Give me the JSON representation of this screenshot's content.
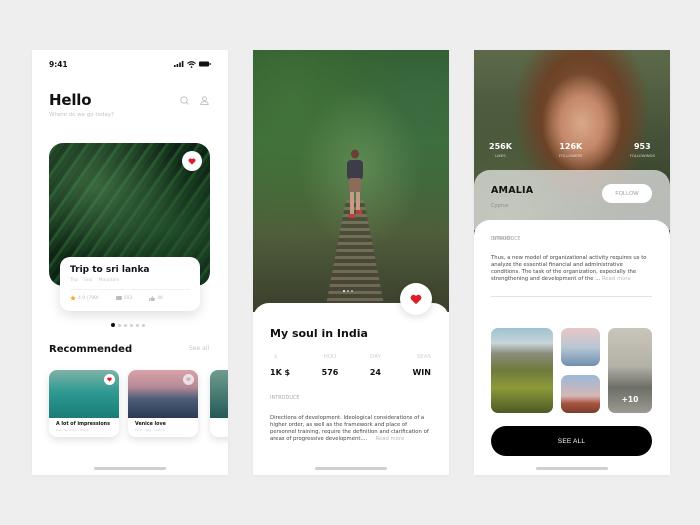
{
  "colors": {
    "accent_red": "#e21b2a",
    "star_orange": "#f5a623",
    "dark": "#000000"
  },
  "screen_home": {
    "status_time": "9:41",
    "greeting": "Hello",
    "subtitle": "Where do we go today?",
    "featured": {
      "title": "Trip to sri lanka",
      "tags": [
        "Trip",
        "Sea",
        "Mountain"
      ],
      "rating": "4.9 (790)",
      "comments": "503",
      "likes": "4K",
      "liked": true
    },
    "carousel": {
      "pages": 6,
      "active_index": 0
    },
    "recommended": {
      "title": "Recommended",
      "see_all": "See all",
      "items": [
        {
          "title": "A lot of impressions",
          "tags": "Sea · Summer · Africa",
          "liked": true
        },
        {
          "title": "Venice love",
          "tags": "Food · Italy · History",
          "liked": false
        }
      ]
    }
  },
  "screen_detail": {
    "title": "My soul in India",
    "stats": [
      {
        "label": "$",
        "value": "1K $"
      },
      {
        "label": "HOU",
        "value": "576"
      },
      {
        "label": "DAY",
        "value": "24"
      },
      {
        "label": "SEAS",
        "value": "WIN"
      }
    ],
    "introduce_label": "INTRODUCE",
    "introduce_text": "Directions of development. Ideological considerations of a higher order, as well as the framework and place of personnel training, require the definition and clarification of areas of progressive development....",
    "read_more": "Read more",
    "carousel": {
      "pages": 3,
      "active_index": 0
    },
    "liked": true
  },
  "screen_profile": {
    "stats": [
      {
        "value": "256K",
        "label": "LIKES"
      },
      {
        "value": "126K",
        "label": "FOLLOWERS"
      },
      {
        "value": "953",
        "label": "FOLLOWINGS"
      }
    ],
    "name": "AMALIA",
    "location": "Cyprus",
    "follow_label": "FOLLOW",
    "introduce_label": "INTRODUCE",
    "introduce_text": "Thus, a new model of organizational activity requires us to analyze the essential financial and administrative conditions. The task of the organization, especially the strengthening and development of the ...",
    "read_more": "Read more",
    "dynamic_label": "DYNAMIC",
    "more_count": "+10",
    "see_all_label": "SEE ALL"
  }
}
